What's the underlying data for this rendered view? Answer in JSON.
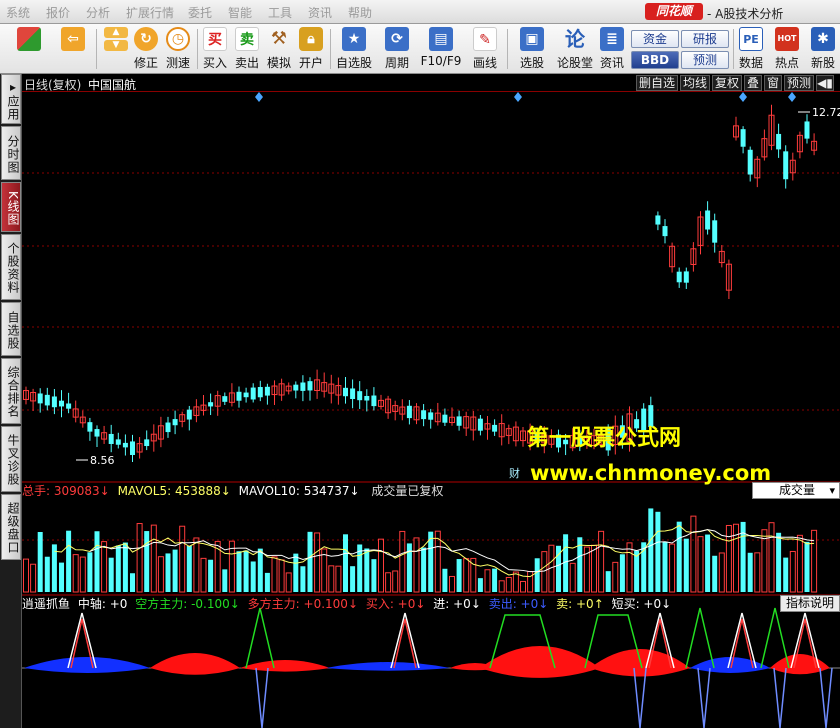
{
  "menubar": {
    "items": [
      "系统",
      "报价",
      "分析",
      "扩展行情",
      "委托",
      "智能",
      "工具",
      "资讯",
      "帮助"
    ],
    "brand": "同花顺",
    "app_title": "- A股技术分析"
  },
  "toolbar": {
    "buttons": [
      {
        "label": "",
        "icon": "layout-grid-icon",
        "color": "#e0463c"
      },
      {
        "label": "",
        "icon": "back-arrow-icon",
        "color": "#f0a52b"
      },
      {
        "label": "修正",
        "icon": "refresh-icon",
        "color": "#f0a52b"
      },
      {
        "label": "测速",
        "icon": "stopwatch-icon",
        "color": "#e58b18"
      },
      {
        "label": "买入",
        "icon": "buy-icon",
        "glyph": "买",
        "color": "#d22"
      },
      {
        "label": "卖出",
        "icon": "sell-icon",
        "glyph": "卖",
        "color": "#1a9a1a"
      },
      {
        "label": "模拟",
        "icon": "hammer-icon",
        "color": "#a06020"
      },
      {
        "label": "开户",
        "icon": "lock-icon",
        "color": "#d8a020"
      },
      {
        "label": "自选股",
        "icon": "star-folder-icon",
        "color": "#3b6fc7"
      },
      {
        "label": "周期",
        "icon": "cycle-icon",
        "color": "#3b6fc7"
      },
      {
        "label": "F10/F9",
        "icon": "f10-icon",
        "color": "#3b6fc7"
      },
      {
        "label": "画线",
        "icon": "pencil-icon",
        "color": "#c22"
      },
      {
        "label": "选股",
        "icon": "monitor-icon",
        "color": "#3b6fc7"
      },
      {
        "label": "论股堂",
        "icon": "forum-icon",
        "glyph": "论",
        "color": "#2a5fb8"
      },
      {
        "label": "资讯",
        "icon": "news-icon",
        "color": "#3b6fc7"
      },
      {
        "label": "数据",
        "icon": "pe-icon",
        "glyph": "PE",
        "color": "#2a5fb8"
      },
      {
        "label": "热点",
        "icon": "hot-icon",
        "glyph": "HOT",
        "color": "#d2321e"
      },
      {
        "label": "新股",
        "icon": "new-stock-icon",
        "color": "#2a5fb8"
      }
    ],
    "small_buttons": [
      "资金",
      "BBD",
      "研报",
      "预测"
    ]
  },
  "leftbar": {
    "tabs": [
      {
        "label": "▸应用",
        "active": false
      },
      {
        "label": "分时图",
        "active": false
      },
      {
        "label": "K线图",
        "active": true
      },
      {
        "label": "个股资料",
        "active": false
      },
      {
        "label": "自选股",
        "active": false
      },
      {
        "label": "综合排名",
        "active": false
      },
      {
        "label": "牛叉诊股",
        "active": false
      },
      {
        "label": "超级盘口",
        "active": false
      }
    ]
  },
  "chart_header": {
    "title": "日线(复权)",
    "stock_name": "中国国航",
    "buttons": [
      "删自选",
      "均线",
      "复权",
      "叠",
      "窗",
      "预测",
      "◀▮",
      "✕"
    ]
  },
  "kline": {
    "high_label": "12.72",
    "low_label": "8.56",
    "watermark_title": "第一股票公式网",
    "watermark_url": "www.chnmoney.com",
    "cai_badge": "财"
  },
  "volume_panel": {
    "legend": [
      {
        "text": "总手: 309083↓",
        "color": "#ff3c3c"
      },
      {
        "text": "MAVOL5: 453888↓",
        "color": "#ffff66"
      },
      {
        "text": "MAVOL10: 534737↓",
        "color": "#ffffff"
      },
      {
        "text": "成交量已复权",
        "color": "#dddddd"
      }
    ],
    "selector": "成交量"
  },
  "indicator_panel": {
    "legend": [
      {
        "text": "逍遥抓鱼",
        "color": "#ffffff"
      },
      {
        "text": "中轴: +0",
        "color": "#ffffff"
      },
      {
        "text": "空方主力: -0.100↓",
        "color": "#22dd22"
      },
      {
        "text": "多方主力: +0.100↓",
        "color": "#ff3c3c"
      },
      {
        "text": "买入: +0↓",
        "color": "#ff3c3c"
      },
      {
        "text": "进: +0↓",
        "color": "#ffffff"
      },
      {
        "text": "卖出: +0↓",
        "color": "#3c5cff"
      },
      {
        "text": "卖: +0↑",
        "color": "#ffff66"
      },
      {
        "text": "短买: +0↓",
        "color": "#ffffff"
      }
    ],
    "button": "指标说明"
  },
  "colors": {
    "up": "#ff3c3c",
    "down": "#54ffff",
    "grid": "#8a0000",
    "ma_white": "#ffffff",
    "ma_yellow": "#ffff66",
    "bull_area": "#ff1111",
    "bear_area": "#1230ff"
  }
}
